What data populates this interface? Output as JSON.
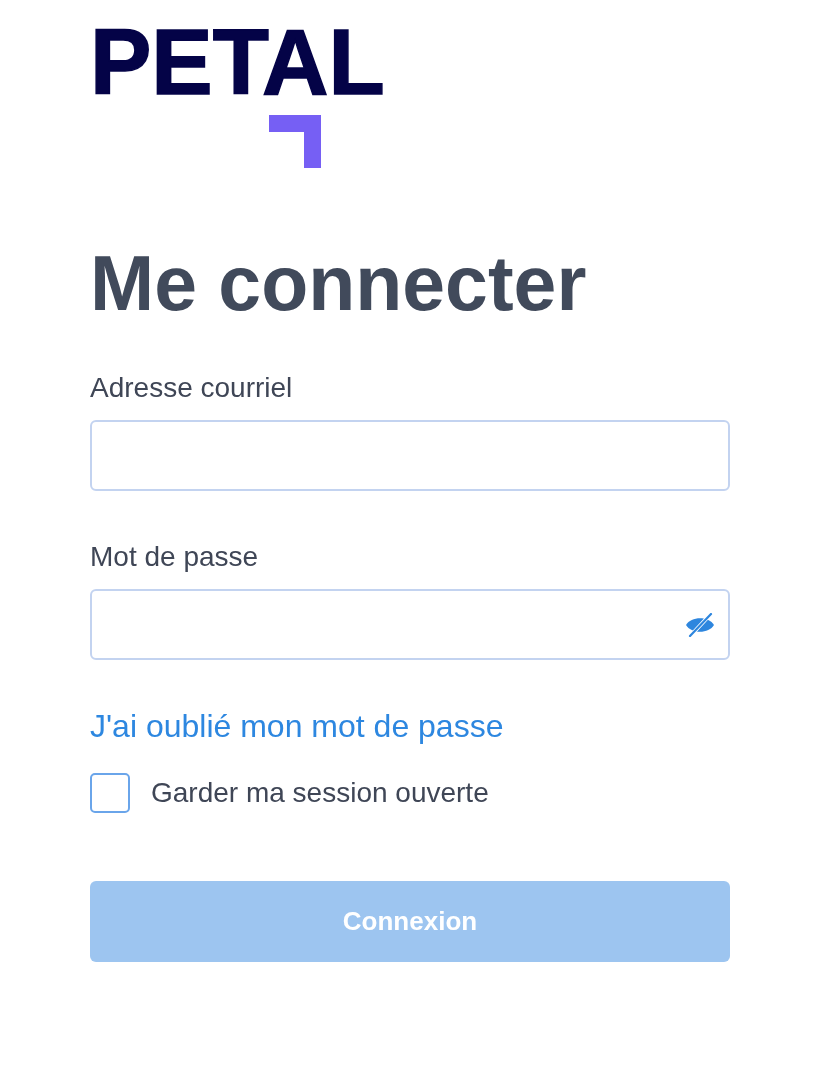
{
  "logo": {
    "text": "PETAL"
  },
  "title": "Me connecter",
  "fields": [
    {
      "label": "Adresse courriel",
      "kind": "email"
    },
    {
      "label": "Mot de passe",
      "kind": "password",
      "revealed": false
    }
  ],
  "forgot_link": "J'ai oublié mon mot de passe",
  "remember": {
    "label": "Garder ma session ouverte",
    "checked": false
  },
  "submit": {
    "label": "Connexion",
    "disabled": true
  }
}
